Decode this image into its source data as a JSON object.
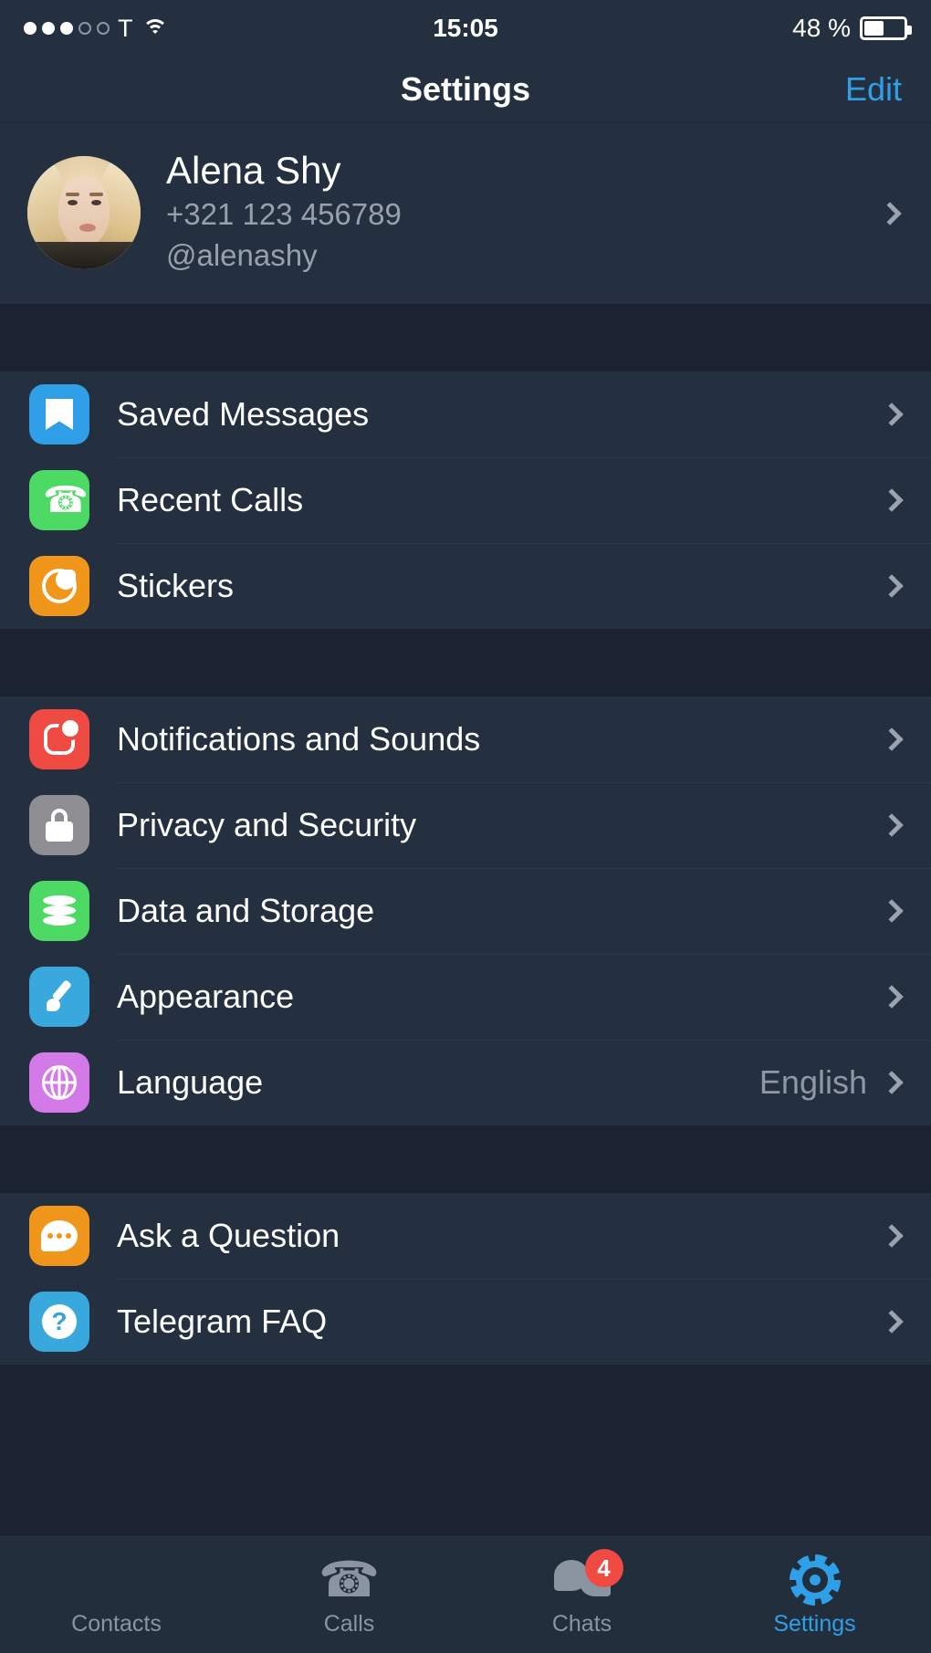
{
  "status_bar": {
    "signal_filled": 3,
    "signal_empty": 2,
    "carrier": "T",
    "wifi_icon": "wifi-icon",
    "time": "15:05",
    "battery_percent": "48 %",
    "battery_level": 48
  },
  "nav": {
    "title": "Settings",
    "edit_label": "Edit",
    "accent_color": "#2f9fe8"
  },
  "profile": {
    "avatar_name": "user-avatar",
    "name": "Alena Shy",
    "phone": "+321 123 456789",
    "username": "@alenashy"
  },
  "sections": [
    {
      "rows": [
        {
          "label": "Saved Messages",
          "icon": "bookmark-icon",
          "icon_color": "#2f9fe8",
          "value": ""
        },
        {
          "label": "Recent Calls",
          "icon": "phone-icon",
          "icon_color": "#4cd964",
          "value": ""
        },
        {
          "label": "Stickers",
          "icon": "sticker-icon",
          "icon_color": "#f0971b",
          "value": ""
        }
      ]
    },
    {
      "rows": [
        {
          "label": "Notifications and Sounds",
          "icon": "bell-icon",
          "icon_color": "#ef4b42",
          "value": ""
        },
        {
          "label": "Privacy and Security",
          "icon": "lock-icon",
          "icon_color": "#8e8e93",
          "value": ""
        },
        {
          "label": "Data and Storage",
          "icon": "database-icon",
          "icon_color": "#4cd964",
          "value": ""
        },
        {
          "label": "Appearance",
          "icon": "paintbrush-icon",
          "icon_color": "#39a9dd",
          "value": ""
        },
        {
          "label": "Language",
          "icon": "globe-icon",
          "icon_color": "#d association",
          "value": "English"
        }
      ]
    },
    {
      "rows": [
        {
          "label": "Ask a Question",
          "icon": "chat-bubble-icon",
          "icon_color": "#f0971b",
          "value": ""
        },
        {
          "label": "Telegram FAQ",
          "icon": "question-mark-icon",
          "icon_color": "#39a9dd",
          "value": ""
        }
      ]
    }
  ],
  "tabbar": {
    "items": [
      {
        "label": "Contacts",
        "icon": "contacts-icon",
        "active": false,
        "badge": ""
      },
      {
        "label": "Calls",
        "icon": "phone-icon",
        "active": false,
        "badge": ""
      },
      {
        "label": "Chats",
        "icon": "chats-icon",
        "active": false,
        "badge": "4"
      },
      {
        "label": "Settings",
        "icon": "gear-icon",
        "active": true,
        "badge": ""
      }
    ]
  }
}
